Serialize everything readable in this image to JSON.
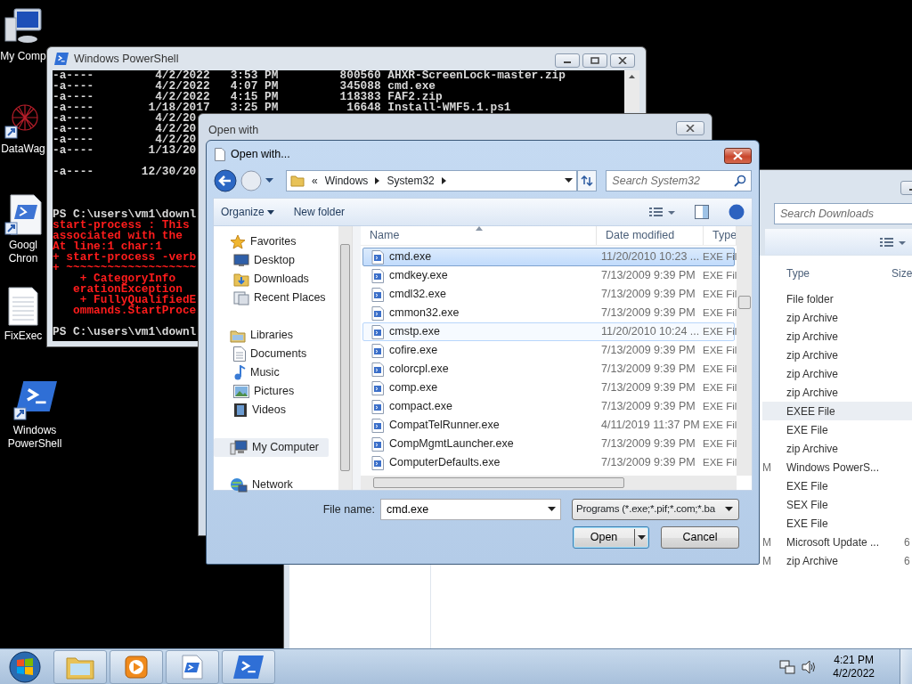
{
  "desktop_icons": [
    {
      "kind": "computer",
      "label": [
        "My Comp"
      ]
    },
    {
      "kind": "web",
      "label": [
        "DataWag"
      ]
    },
    {
      "kind": "script",
      "label": [
        "Googl",
        "Chron"
      ]
    },
    {
      "kind": "text",
      "label": [
        "FixExec"
      ]
    },
    {
      "kind": "powershell",
      "label": [
        "Windows",
        "PowerShell"
      ]
    }
  ],
  "explorer_window": {
    "search": {
      "placeholder": "Search Downloads"
    },
    "columns": [
      "Type",
      "Size"
    ],
    "rows": [
      {
        "type": "File folder",
        "selected": false
      },
      {
        "type": "zip Archive",
        "selected": false
      },
      {
        "type": "zip Archive",
        "selected": false
      },
      {
        "type": "zip Archive",
        "selected": false
      },
      {
        "type": "zip Archive",
        "selected": false
      },
      {
        "type": "zip Archive",
        "selected": false
      },
      {
        "type": "EXEE File",
        "selected": true
      },
      {
        "type": "EXE File",
        "selected": false
      },
      {
        "type": "zip Archive",
        "selected": false
      },
      {
        "date": "M",
        "type": "Windows PowerS...",
        "selected": false
      },
      {
        "type": "EXE File",
        "selected": false
      },
      {
        "type": "SEX File",
        "selected": false
      },
      {
        "type": "EXE File",
        "selected": false
      },
      {
        "date": "M",
        "type": "Microsoft Update ...",
        "size": "6",
        "selected": false
      },
      {
        "date": "M",
        "type": "zip Archive",
        "size": "6",
        "selected": false
      }
    ]
  },
  "powershell_window": {
    "title": "Windows PowerShell",
    "console": [
      {
        "kind": "output",
        "text": "-a----         4/2/2022   3:53 PM         800560 AHXR-ScreenLock-master.zip"
      },
      {
        "kind": "output",
        "text": "-a----         4/2/2022   4:07 PM         345088 cmd.exe"
      },
      {
        "kind": "output",
        "text": "-a----         4/2/2022   4:15 PM         118383 FAF2.zip"
      },
      {
        "kind": "output",
        "text": "-a----        1/18/2017   3:25 PM          16648 Install-WMF5.1.ps1"
      },
      {
        "kind": "output",
        "text": "-a----         4/2/20"
      },
      {
        "kind": "output",
        "text": "-a----         4/2/20"
      },
      {
        "kind": "output",
        "text": "-a----         4/2/20"
      },
      {
        "kind": "output",
        "text": "-a----        1/13/20"
      },
      {
        "kind": "blank"
      },
      {
        "kind": "output",
        "text": "-a----       12/30/20"
      },
      {
        "kind": "blank"
      },
      {
        "kind": "blank"
      },
      {
        "kind": "blank"
      },
      {
        "kind": "output",
        "text": "PS C:\\users\\vm1\\downl"
      },
      {
        "kind": "error",
        "text": "start-process : This"
      },
      {
        "kind": "error",
        "text": "associated with the"
      },
      {
        "kind": "error",
        "text": "At line:1 char:1"
      },
      {
        "kind": "error",
        "text": "+ start-process -verb"
      },
      {
        "kind": "error",
        "text": "+ ~~~~~~~~~~~~~~~~~~~"
      },
      {
        "kind": "error",
        "text": "    + CategoryInfo"
      },
      {
        "kind": "error",
        "text": "   erationException"
      },
      {
        "kind": "error",
        "text": "    + FullyQualifiedE"
      },
      {
        "kind": "error",
        "text": "   ommands.StartProce"
      },
      {
        "kind": "blank"
      },
      {
        "kind": "output",
        "text": "PS C:\\users\\vm1\\downl"
      }
    ]
  },
  "open_with_dialog": {
    "title": "Open with"
  },
  "file_dialog": {
    "title": "Open with...",
    "path_overflow": "«",
    "path": [
      "Windows",
      "System32"
    ],
    "search": {
      "placeholder": "Search System32"
    },
    "toolbar": {
      "organize": "Organize",
      "new_folder": "New folder"
    },
    "navigation": [
      {
        "label": "Favorites",
        "kind": "star",
        "selected": false,
        "children": [
          {
            "label": "Desktop",
            "kind": "desktop",
            "selected": false
          },
          {
            "label": "Downloads",
            "kind": "downloads",
            "selected": false
          },
          {
            "label": "Recent Places",
            "kind": "recent",
            "selected": false
          }
        ]
      },
      {
        "label": "Libraries",
        "kind": "libraries",
        "selected": false,
        "children": [
          {
            "label": "Documents",
            "kind": "documents",
            "selected": false
          },
          {
            "label": "Music",
            "kind": "music",
            "selected": false
          },
          {
            "label": "Pictures",
            "kind": "pictures",
            "selected": false
          },
          {
            "label": "Videos",
            "kind": "videos",
            "selected": false
          }
        ]
      },
      {
        "label": "My Computer",
        "kind": "computer",
        "selected": true
      },
      {
        "label": "Network",
        "kind": "network",
        "selected": false
      }
    ],
    "columns": [
      "Name",
      "Date modified",
      "Type"
    ],
    "files": [
      {
        "name": "cmd.exe",
        "date": "11/20/2010 10:23 ...",
        "type": "EXE Fil",
        "selected": true,
        "hovered": false
      },
      {
        "name": "cmdkey.exe",
        "date": "7/13/2009 9:39 PM",
        "type": "EXE Fil",
        "selected": false,
        "hovered": false
      },
      {
        "name": "cmdl32.exe",
        "date": "7/13/2009 9:39 PM",
        "type": "EXE Fil",
        "selected": false,
        "hovered": false
      },
      {
        "name": "cmmon32.exe",
        "date": "7/13/2009 9:39 PM",
        "type": "EXE Fil",
        "selected": false,
        "hovered": false
      },
      {
        "name": "cmstp.exe",
        "date": "11/20/2010 10:24 ...",
        "type": "EXE Fil",
        "selected": false,
        "hovered": true
      },
      {
        "name": "cofire.exe",
        "date": "7/13/2009 9:39 PM",
        "type": "EXE Fil",
        "selected": false,
        "hovered": false
      },
      {
        "name": "colorcpl.exe",
        "date": "7/13/2009 9:39 PM",
        "type": "EXE Fil",
        "selected": false,
        "hovered": false
      },
      {
        "name": "comp.exe",
        "date": "7/13/2009 9:39 PM",
        "type": "EXE Fil",
        "selected": false,
        "hovered": false
      },
      {
        "name": "compact.exe",
        "date": "7/13/2009 9:39 PM",
        "type": "EXE Fil",
        "selected": false,
        "hovered": false
      },
      {
        "name": "CompatTelRunner.exe",
        "date": "4/11/2019 11:37 PM",
        "type": "EXE Fil",
        "selected": false,
        "hovered": false
      },
      {
        "name": "CompMgmtLauncher.exe",
        "date": "7/13/2009 9:39 PM",
        "type": "EXE Fil",
        "selected": false,
        "hovered": false
      },
      {
        "name": "ComputerDefaults.exe",
        "date": "7/13/2009 9:39 PM",
        "type": "EXE Fil",
        "selected": false,
        "hovered": false
      }
    ],
    "file_name": {
      "label": "File name:",
      "value": "cmd.exe"
    },
    "filter": "Programs (*.exe;*.pif;*.com;*.ba",
    "buttons": {
      "open": "Open",
      "cancel": "Cancel"
    }
  },
  "taskbar": {
    "items": [
      {
        "kind": "explorer"
      },
      {
        "kind": "media"
      },
      {
        "kind": "script"
      },
      {
        "kind": "powershell"
      }
    ],
    "clock": {
      "time": "4:21 PM",
      "date": "4/2/2022"
    }
  }
}
